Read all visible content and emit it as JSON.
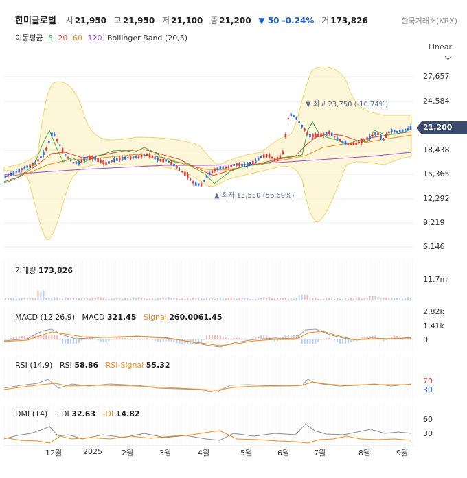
{
  "header": {
    "name": "한미글로벌",
    "open_label": "시",
    "open": "21,950",
    "high_label": "고",
    "high": "21,950",
    "low_label": "저",
    "low": "21,100",
    "close_label": "종",
    "close": "21,200",
    "change_arrow": "▼",
    "change": "50",
    "change_pct": "-0.24%",
    "volume_label": "거",
    "volume": "173,826",
    "exchange": "한국거래소(KRX)",
    "scale_mode": "Linear"
  },
  "indicators": {
    "ma_label": "이동평균",
    "ma5": "5",
    "ma20": "20",
    "ma60": "60",
    "ma120": "120",
    "bb_label": "Bollinger Band (20,5)"
  },
  "colors": {
    "up": "#e13b3b",
    "down": "#2e6fd8",
    "ma5": "#3cb44b",
    "ma20": "#e8463a",
    "ma60": "#f08c1a",
    "ma120": "#9b4fd6",
    "band": "#f5d36a",
    "macd": "#9a9a9a",
    "signal": "#f08c1a"
  },
  "chart_data": [
    {
      "type": "line",
      "title": "",
      "y_ticks": [
        "27,657",
        "24,584",
        "21,200",
        "18,438",
        "15,365",
        "12,292",
        "9,219",
        "6,146"
      ],
      "ylim": [
        6146,
        27657
      ],
      "current_price": "21,200",
      "annotations": [
        {
          "label": "▼ 최고 23,750 (-10.74%)",
          "value": 23750
        },
        {
          "label": "▲ 최저 13,530 (56.69%)",
          "value": 13530
        }
      ],
      "x_ticks": [
        "12월",
        "2025",
        "2월",
        "3월",
        "4월",
        "5월",
        "6월",
        "7월",
        "8월",
        "9월"
      ],
      "series": [
        {
          "name": "5",
          "color": "#3cb44b"
        },
        {
          "name": "20",
          "color": "#e8463a"
        },
        {
          "name": "60",
          "color": "#f08c1a"
        },
        {
          "name": "120",
          "color": "#9b4fd6"
        }
      ],
      "price_path": [
        15000,
        15400,
        15800,
        16200,
        16600,
        17200,
        18400,
        20700,
        19100,
        17600,
        16800,
        16800,
        17400,
        17400,
        17000,
        16700,
        17100,
        17300,
        17400,
        17500,
        17600,
        17800,
        17400,
        17100,
        17000,
        16500,
        15800,
        15100,
        14100,
        14000,
        15300,
        15900,
        16200,
        16200,
        16600,
        16500,
        16600,
        16900,
        17600,
        17700,
        17100,
        17700,
        23000,
        22500,
        21300,
        20200,
        20200,
        20300,
        20600,
        19900,
        19400,
        19100,
        19200,
        19600,
        20000,
        20600,
        19700,
        20900,
        20700,
        20900,
        21200
      ]
    },
    {
      "type": "bar",
      "title": "거래량",
      "value": "173,826",
      "y_ticks": [
        "11.7m"
      ]
    },
    {
      "type": "line",
      "title": "MACD (12,26,9)",
      "macd": "321.45",
      "signal": "260.0061.45",
      "y_ticks": [
        "2.82k",
        "1.41k",
        "0"
      ]
    },
    {
      "type": "line",
      "title": "RSI (14,9)",
      "rsi": "58.86",
      "rsi_signal": "55.32",
      "y_ticks": [
        "70",
        "30"
      ]
    },
    {
      "type": "line",
      "title": "DMI (14)",
      "plus_di": "32.63",
      "minus_di": "14.82",
      "y_ticks": [
        "60",
        "30"
      ]
    }
  ],
  "labels": {
    "macd_key": "MACD",
    "signal_key": "Signal",
    "rsi_key": "RSI",
    "rsi_signal_key": "RSI-Signal",
    "plus_di_key": "+DI",
    "minus_di_key": "-DI"
  }
}
